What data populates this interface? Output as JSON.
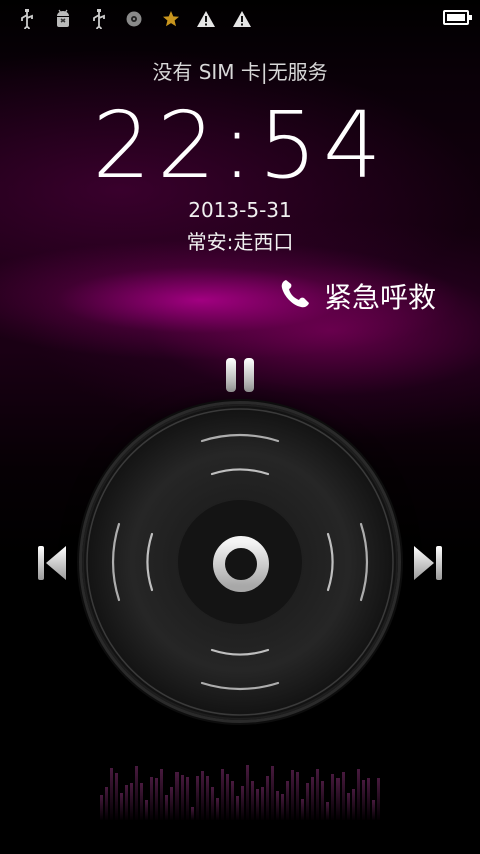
{
  "status_bar": {
    "icons": [
      "usb-icon",
      "android-debug-icon",
      "usb-icon",
      "media-disc-icon",
      "star-icon",
      "warning-icon",
      "warning-icon"
    ],
    "battery_level": 1.0
  },
  "carrier_text": "没有 SIM 卡|无服务",
  "clock": "22:54",
  "date": "2013-5-31",
  "next_alarm": "常安:走西口",
  "emergency_label": "紧急呼救",
  "colors": {
    "accent": "#b0008c",
    "text": "#ffffff"
  }
}
